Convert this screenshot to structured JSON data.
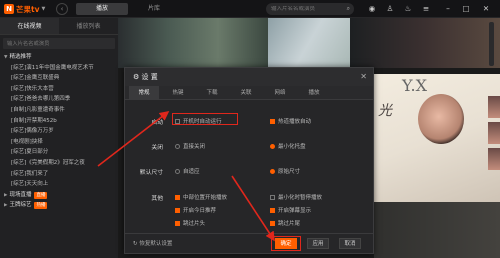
{
  "app": {
    "logo_text": "芒果tv"
  },
  "topbar": {
    "tabs": [
      {
        "label": "播放"
      },
      {
        "label": "片库"
      }
    ],
    "search_placeholder": "输入片名名或演员"
  },
  "sidebar": {
    "tabs": [
      {
        "label": "在线视频"
      },
      {
        "label": "播放列表"
      }
    ],
    "search_placeholder": "输入片名名或演员",
    "items": [
      {
        "label": "精选推荐",
        "type": "group"
      },
      {
        "label": "[综艺]演11年中国金鹰电视艺术节",
        "type": "item"
      },
      {
        "label": "[综艺]金鹰互联盛典",
        "type": "item"
      },
      {
        "label": "[综艺]快乐大本营",
        "type": "item"
      },
      {
        "label": "[综艺]爸爸去哪儿第四季",
        "type": "item"
      },
      {
        "label": "[自制]凡影童遭奇事件",
        "type": "item"
      },
      {
        "label": "[自制]开禁期452b",
        "type": "item"
      },
      {
        "label": "[综艺]偶像万万岁",
        "type": "item"
      },
      {
        "label": "[电视剧]抉择",
        "type": "item"
      },
      {
        "label": "[综艺]夏日部分",
        "type": "item"
      },
      {
        "label": "[综艺]《完美假期2》冠军之夜",
        "type": "item"
      },
      {
        "label": "[综艺]我们来了",
        "type": "item"
      },
      {
        "label": "[综艺]天天向上",
        "type": "item"
      },
      {
        "label": "现场直播",
        "type": "group",
        "badge": "直播"
      },
      {
        "label": "王牌综艺",
        "type": "group",
        "badge": "热播"
      }
    ]
  },
  "poster": {
    "title": "光",
    "subtitle": "Y.X"
  },
  "dialog": {
    "title": "设 置",
    "tabs": [
      {
        "label": "常规"
      },
      {
        "label": "热键"
      },
      {
        "label": "下载"
      },
      {
        "label": "关联"
      },
      {
        "label": "网络"
      },
      {
        "label": "播放"
      }
    ],
    "sections": {
      "startup": {
        "label": "启动",
        "left": {
          "label": "开机时自动运行",
          "checked": false
        },
        "right": {
          "label": "热道播放自动",
          "checked": true
        }
      },
      "close": {
        "label": "关闭",
        "left": {
          "label": "直接关闭",
          "selected": false
        },
        "right": {
          "label": "最小化托盘",
          "selected": true
        }
      },
      "default_size": {
        "label": "默认尺寸",
        "left": {
          "label": "自适应",
          "selected": false
        },
        "right": {
          "label": "原始尺寸",
          "selected": true
        }
      },
      "other": {
        "label": "其他",
        "options": [
          {
            "label": "中部位置开始播放",
            "checked": true
          },
          {
            "label": "最小化时暂停播放",
            "checked": false
          },
          {
            "label": "开启今日推荐",
            "checked": true
          },
          {
            "label": "开启弹幕显示",
            "checked": true
          },
          {
            "label": "跳过片头",
            "checked": true
          },
          {
            "label": "跳过片尾",
            "checked": true
          }
        ]
      }
    },
    "footer": {
      "reset_label": "恢复默认设置",
      "ok_label": "确定",
      "apply_label": "应用",
      "cancel_label": "取消"
    }
  },
  "colors": {
    "accent": "#ff5f00",
    "highlight": "#e0271c"
  }
}
